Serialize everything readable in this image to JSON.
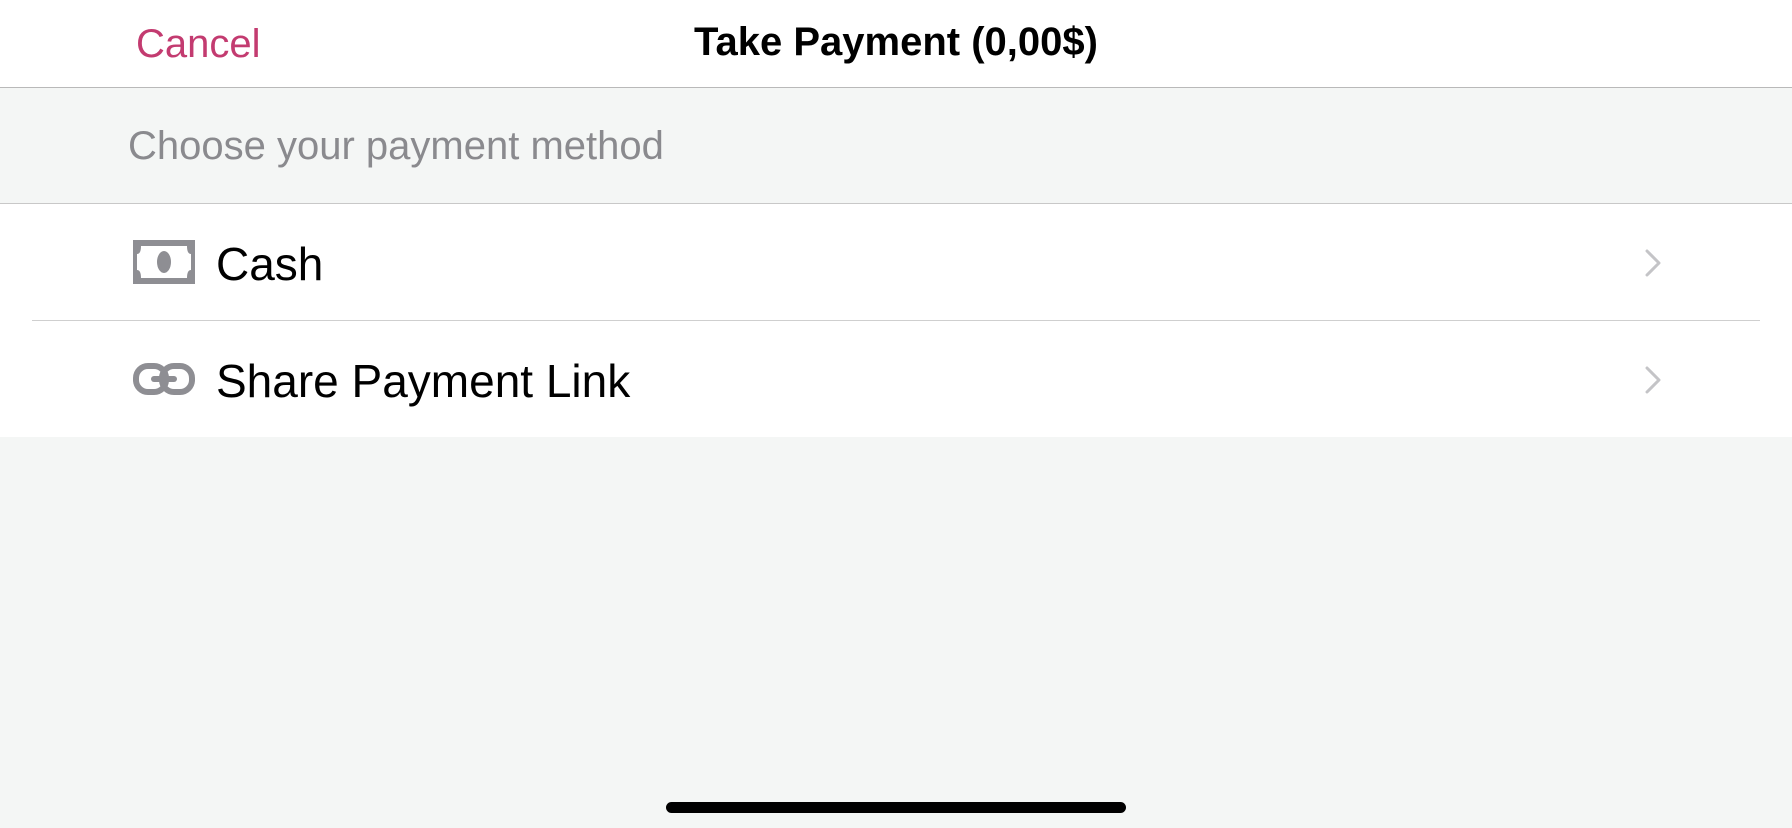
{
  "navbar": {
    "cancel_label": "Cancel",
    "title": "Take Payment (0,00$)"
  },
  "section": {
    "header": "Choose your payment method"
  },
  "payment_methods": [
    {
      "label": "Cash",
      "icon": "banknote-icon"
    },
    {
      "label": "Share Payment Link",
      "icon": "link-icon"
    }
  ],
  "colors": {
    "accent": "#c33b70",
    "background": "#f4f6f5",
    "secondary_text": "#8a8a8e",
    "icon_gray": "#8e8e93"
  }
}
